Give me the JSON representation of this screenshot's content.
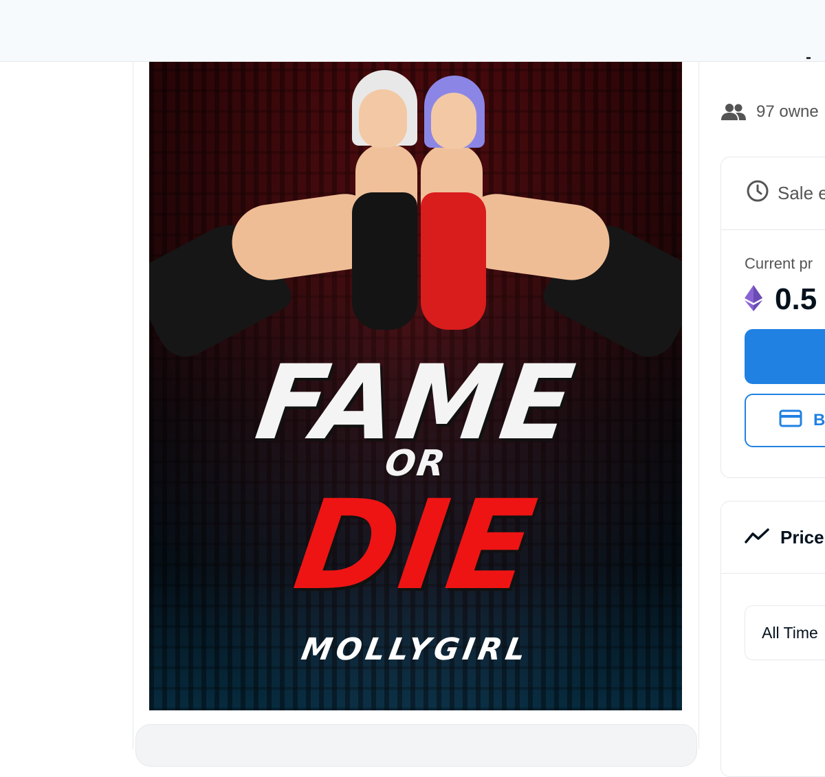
{
  "artwork": {
    "title_line1": "FAME",
    "title_line2": "OR",
    "title_line3": "DIE",
    "signature": "MOLLYGIRL"
  },
  "sidebar": {
    "owners_text": "97 owne",
    "sale": {
      "header_text": "Sale e",
      "current_price_label": "Current pr",
      "price_value": "0.5",
      "offer_label": "B"
    },
    "price_history": {
      "title": "Price",
      "time_range": "All Time"
    }
  },
  "colors": {
    "accent": "#2081e2",
    "eth": "#8a63d2",
    "muted": "#545454"
  },
  "icons": {
    "owners": "people-icon",
    "sale": "clock-icon",
    "currency": "ethereum-icon",
    "offer": "credit-card-icon",
    "chart": "trend-line-icon"
  }
}
